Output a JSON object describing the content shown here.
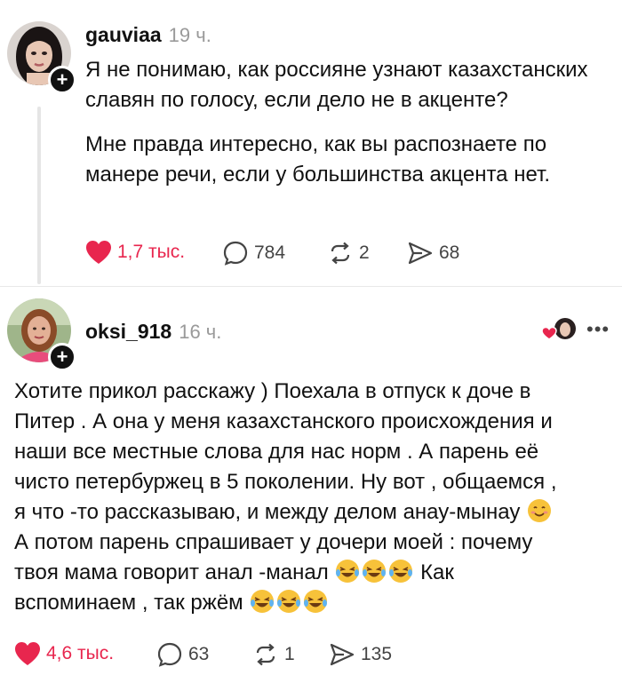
{
  "posts": [
    {
      "username": "gauviaa",
      "time": "19 ч.",
      "paragraphs": [
        "Я не понимаю, как россияне узнают казахстанских славян по голосу, если дело не в акценте?",
        "Мне правда интересно, как вы распознаете по манере речи, если у большинства акцента нет."
      ],
      "actions": {
        "likes": "1,7 тыс.",
        "comments": "784",
        "reposts": "2",
        "shares": "68"
      }
    },
    {
      "username": "oksi_918",
      "time": "16 ч.",
      "lines": [
        "Хотите прикол расскажу ) Поехала в отпуск к доче в",
        "Питер . А она у меня казахстанского происхождения и",
        "наши все местные слова для нас норм . А парень её",
        "чисто петербуржец в 5 поколении. Ну вот , общаемся ,",
        "я что -то рассказываю, и между делом анау-мынау",
        "А потом парень спрашивает у дочери моей : почему",
        "твоя мама говорит анал -манал",
        "Как",
        "вспоминаем , так ржём"
      ],
      "actions": {
        "likes": "4,6 тыс.",
        "comments": "63",
        "reposts": "1",
        "shares": "135"
      }
    }
  ],
  "icons": [
    "plus-icon",
    "heart-icon",
    "comment-icon",
    "repost-icon",
    "share-icon",
    "more-icon",
    "smile-emoji-icon",
    "laughing-emoji-icon"
  ],
  "colors": {
    "like": "#e8264e",
    "muted": "#9a9a9a",
    "text": "#111111",
    "line": "#e5e5e5"
  }
}
